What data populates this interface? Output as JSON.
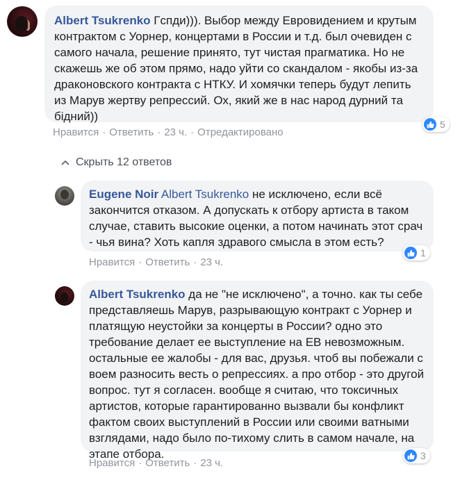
{
  "comment1": {
    "author": "Albert Tsukrenko",
    "text": "Гспди))). Выбор между Евровидением и крутым контрактом с Уорнер, концертами в России и т.д. был очевиден с самого начала, решение принято, тут чистая прагматика. Но не скажешь же об этом прямо, надо уйти со скандалом - якобы из-за драконовского контракта с НТКУ. И хомячки теперь будут лепить из Марув жертву репрессий. Ох, який же в нас народ дурний та бідний))",
    "like": "Нравится",
    "reply": "Ответить",
    "time": "23 ч.",
    "edited": "Отредактировано",
    "reactions": "5"
  },
  "hide_replies": "Скрыть 12 ответов",
  "reply1": {
    "author": "Eugene Noir",
    "mention": "Albert Tsukrenko",
    "text": " не исключено, если всё закончится отказом. А допускать к отбору артиста в таком случае, ставить высокие оценки, а потом начинать этот срач - чья вина? Хоть капля здравого смысла в этом есть?",
    "like": "Нравится",
    "reply": "Ответить",
    "time": "23 ч.",
    "reactions": "1"
  },
  "reply2": {
    "author": "Albert Tsukrenko",
    "text": " да не \"не исключено\", а точно. как ты себе представляешь Марув, разрывающую контракт с Уорнер и платящую неустойки за концерты в России? одно это требование делает ее выступление на ЕВ невозможным. остальные ее жалобы - для вас, друзья. чтоб вы побежали с воем разносить весть о репрессиях. а про отбор - это другой вопрос. тут я согласен. вообще я считаю, что токсичных артистов, которые гарантированно вызвали бы конфликт фактом своих выступлений в России или своими ватными взглядами, надо было по-тихому слить в самом начале, на этапе отбора.",
    "like": "Нравится",
    "reply": "Ответить",
    "time": "23 ч.",
    "reactions": "3"
  },
  "separator": "·",
  "colors": {
    "link": "#365899",
    "bubble": "#f2f3f5",
    "like": "#2d88ff"
  }
}
